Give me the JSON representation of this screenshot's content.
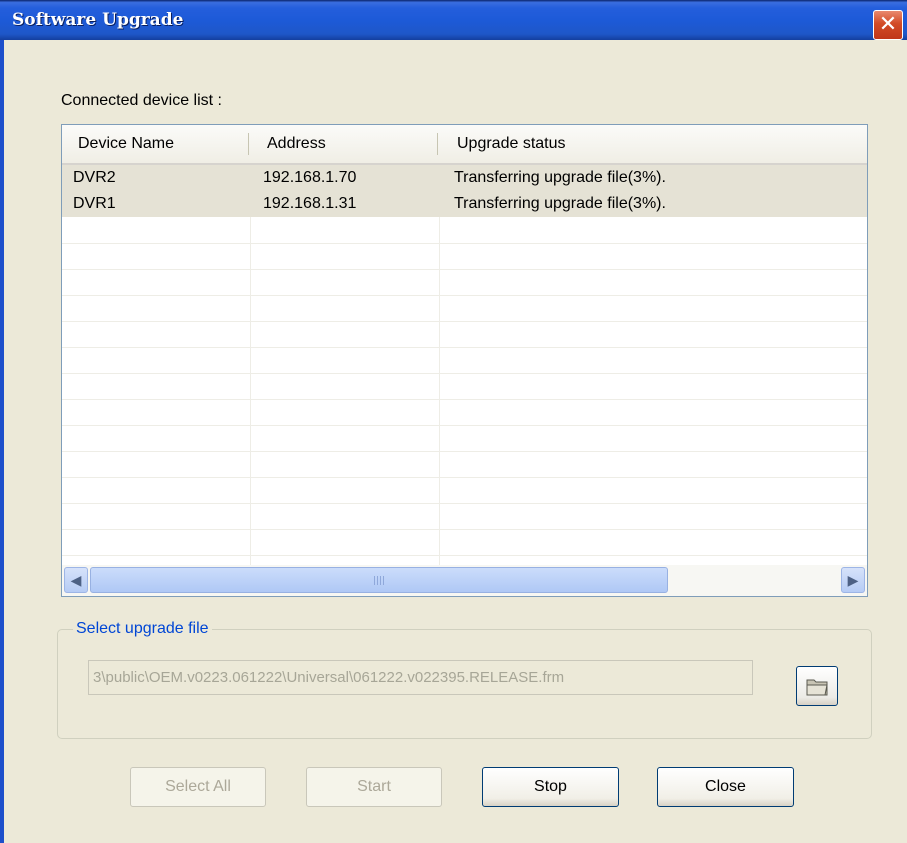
{
  "window": {
    "title": "Software Upgrade",
    "close_glyph": "✕"
  },
  "device_list": {
    "label": "Connected device list :",
    "columns": [
      "Device Name",
      "Address",
      "Upgrade status"
    ],
    "rows": [
      {
        "name": "DVR2",
        "address": "192.168.1.70",
        "status": "Transferring upgrade file(3%)."
      },
      {
        "name": "DVR1",
        "address": "192.168.1.31",
        "status": "Transferring upgrade file(3%)."
      }
    ]
  },
  "scrollbar": {
    "left_icon": "arrow-left-icon",
    "right_icon": "arrow-right-icon",
    "left_glyph": "◀",
    "right_glyph": "▶"
  },
  "upgrade_file": {
    "legend": "Select upgrade file",
    "path": "3\\public\\OEM.v0223.061222\\Universal\\061222.v022395.RELEASE.frm",
    "browse_icon": "folder-icon"
  },
  "buttons": {
    "select_all": "Select All",
    "start": "Start",
    "stop": "Stop",
    "close": "Close"
  },
  "colors": {
    "titlebar": "#245EDC",
    "client": "#ECE9D8",
    "legend_text": "#0046D5",
    "close_button": "#D24B26"
  }
}
